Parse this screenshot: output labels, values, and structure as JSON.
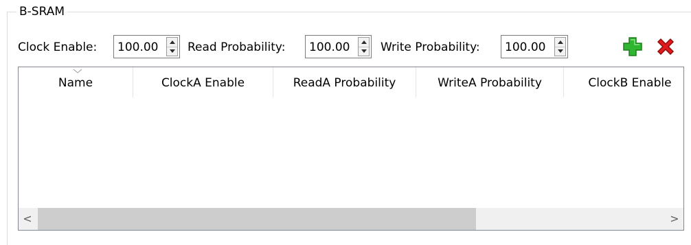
{
  "group": {
    "title": "B-SRAM"
  },
  "controls": {
    "clock_enable": {
      "label": "Clock Enable:",
      "value": "100.00"
    },
    "read_probability": {
      "label": "Read Probability:",
      "value": "100.00"
    },
    "write_probability": {
      "label": "Write Probability:",
      "value": "100.00"
    },
    "add_icon": "plus-icon",
    "delete_icon": "close-icon",
    "colors": {
      "add": "#2fb52f",
      "delete": "#e01b1b"
    }
  },
  "table": {
    "columns": [
      "Name",
      "ClockA Enable",
      "ReadA Probability",
      "WriteA Probability",
      "ClockB Enable"
    ],
    "rows": [],
    "scrollbar": {
      "left_arrow": "<",
      "right_arrow": ">"
    }
  }
}
